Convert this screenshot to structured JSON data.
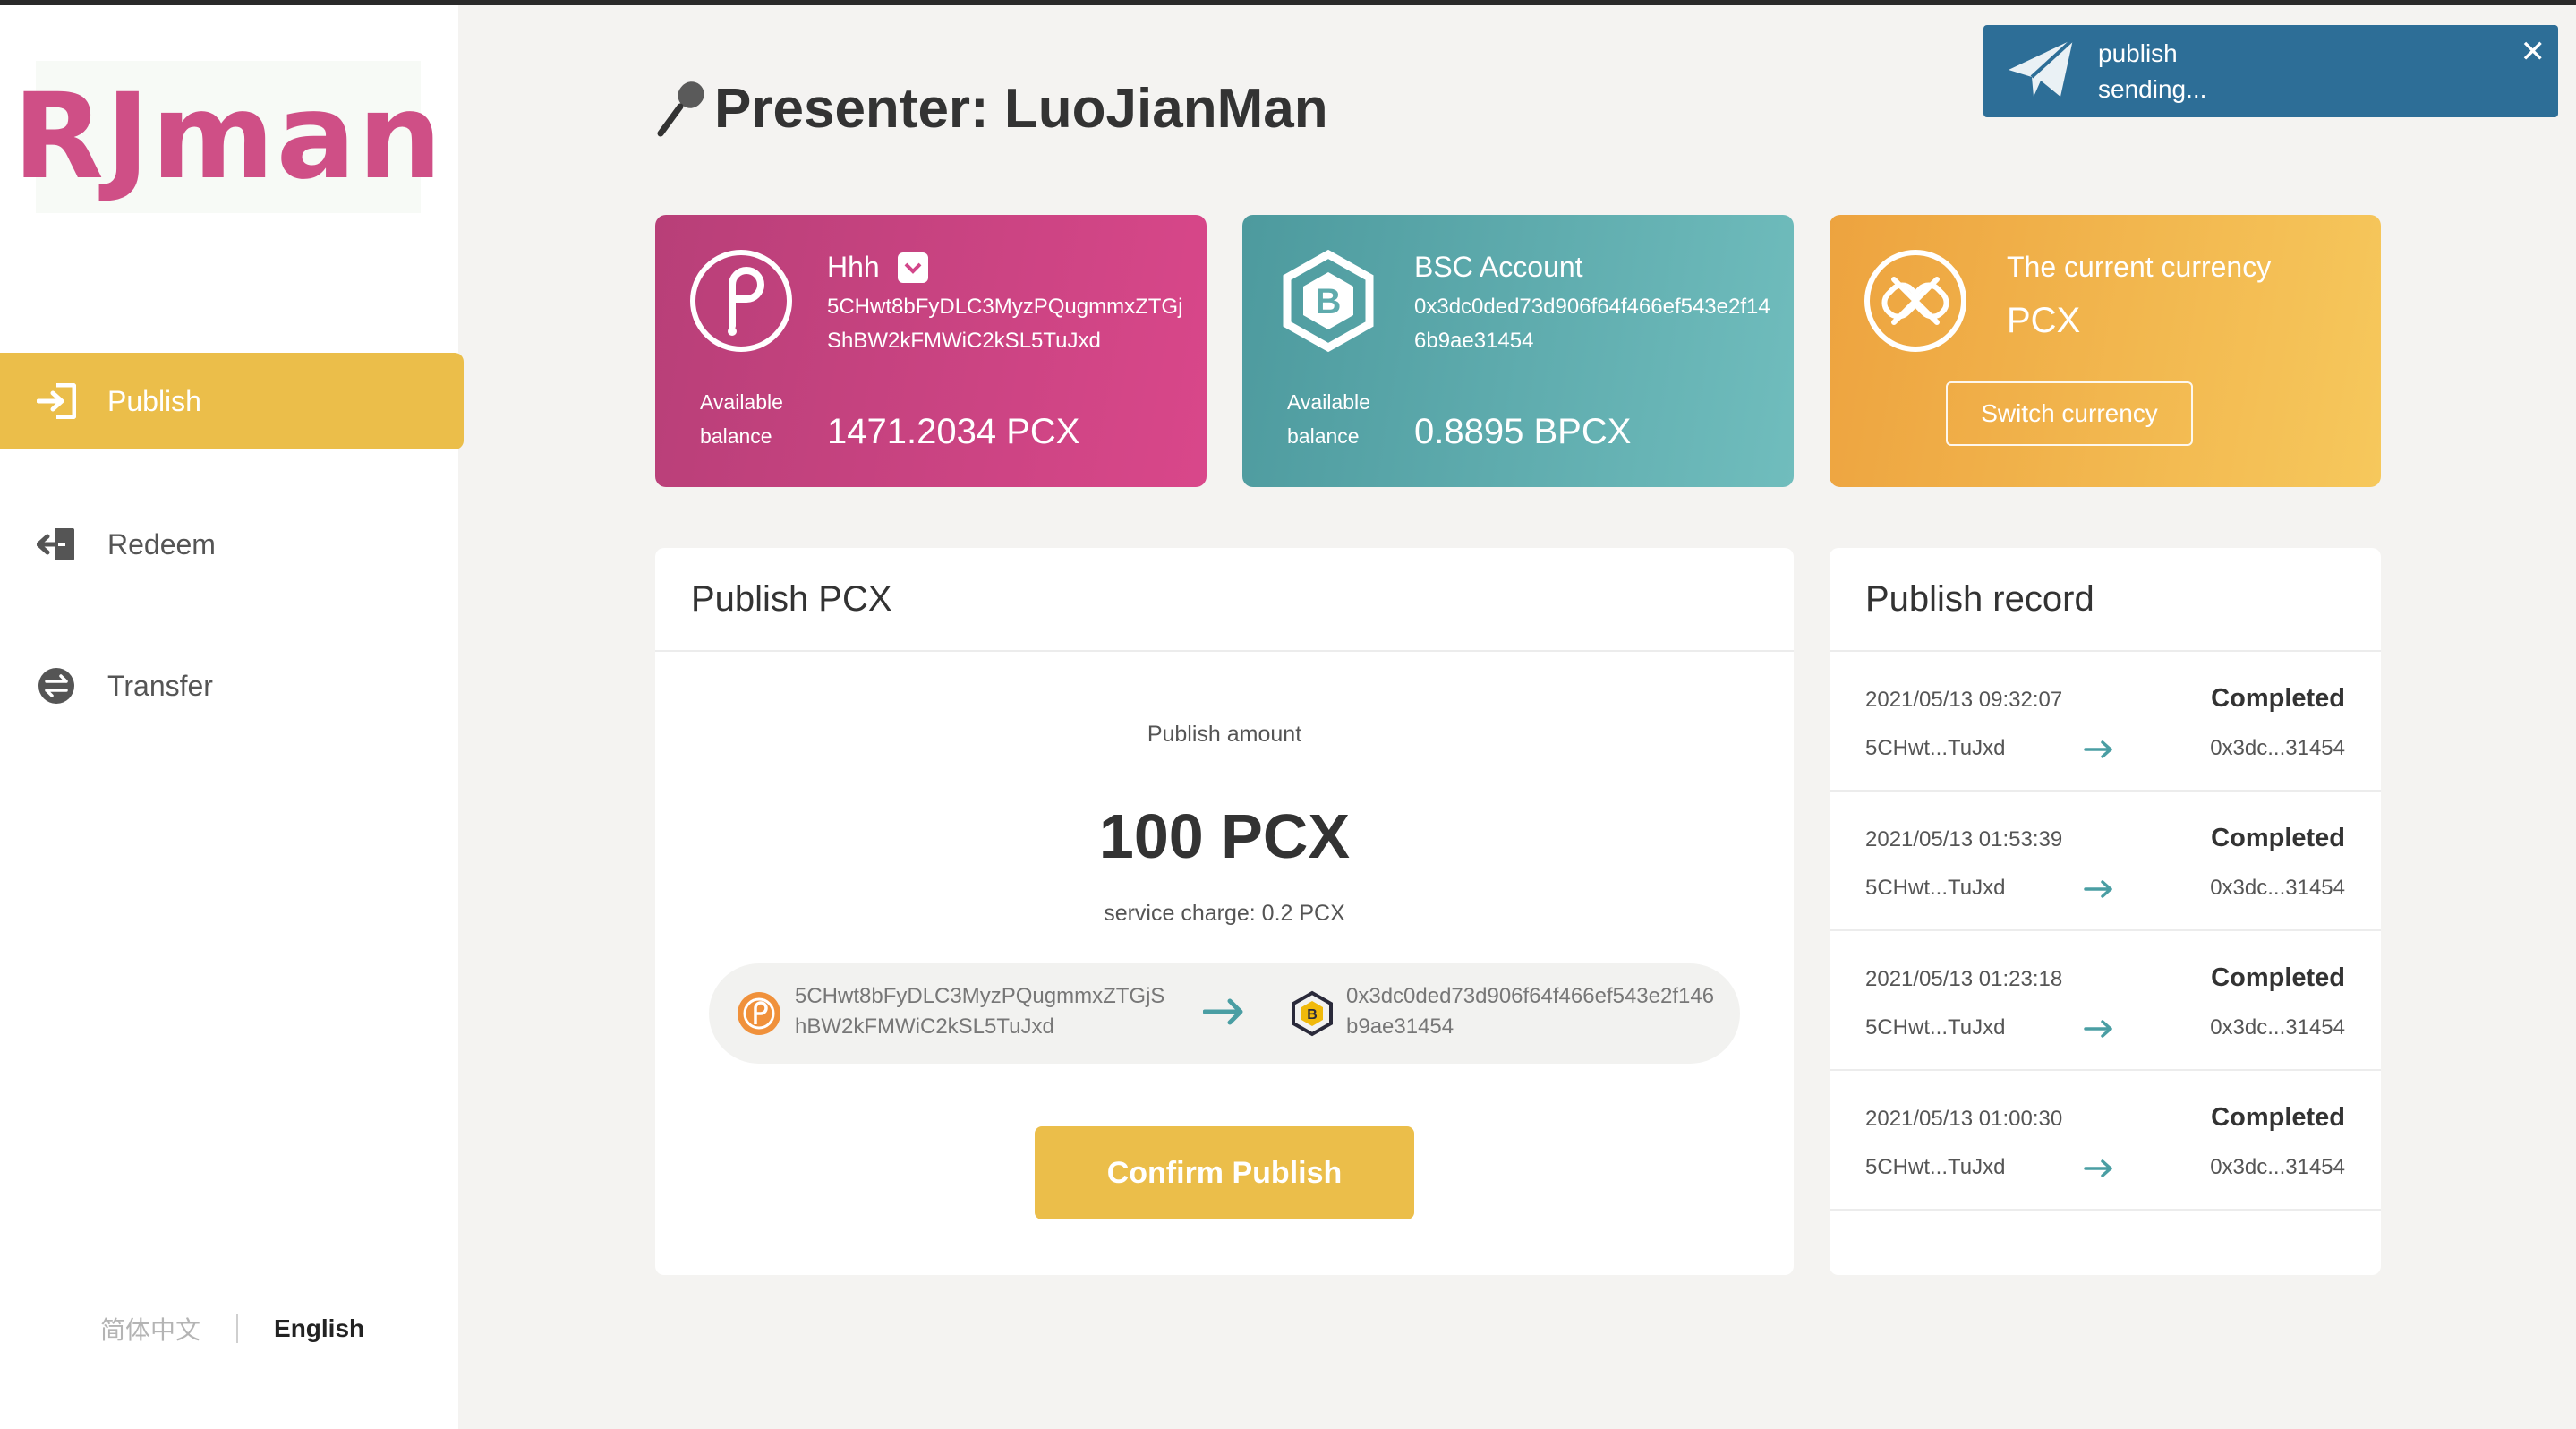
{
  "app": {
    "logo_text": "RJman"
  },
  "sidebar": {
    "items": [
      {
        "label": "Publish",
        "icon": "publish-icon",
        "active": true
      },
      {
        "label": "Redeem",
        "icon": "redeem-icon",
        "active": false
      },
      {
        "label": "Transfer",
        "icon": "transfer-icon",
        "active": false
      }
    ],
    "lang_zh": "简体中文",
    "lang_en": "English"
  },
  "header": {
    "presenter": "Presenter: LuoJianMan"
  },
  "toast": {
    "title": "publish",
    "message": "sending...",
    "close": "✕"
  },
  "cards": {
    "account": {
      "name": "Hhh",
      "address": "5CHwt8bFyDLC3MyzPQugmmxZTGjShBW2kFMWiC2kSL5TuJxd",
      "avail_line1": "Available",
      "avail_line2": "balance",
      "balance": "1471.2034 PCX"
    },
    "bsc": {
      "name": "BSC Account",
      "address": "0x3dc0ded73d906f64f466ef543e2f146b9ae31454",
      "avail_line1": "Available",
      "avail_line2": "balance",
      "balance": "0.8895 BPCX"
    },
    "currency": {
      "title": "The current currency",
      "value": "PCX",
      "switch_label": "Switch currency"
    }
  },
  "publish": {
    "title": "Publish PCX",
    "amount_label": "Publish amount",
    "amount": "100 PCX",
    "service_charge": "service charge:  0.2 PCX",
    "from_address": "5CHwt8bFyDLC3MyzPQugmmxZTGjShBW2kFMWiC2kSL5TuJxd",
    "to_address": "0x3dc0ded73d906f64f466ef543e2f146b9ae31454",
    "confirm_label": "Confirm Publish"
  },
  "records": {
    "title": "Publish record",
    "items": [
      {
        "date": "2021/05/13 09:32:07",
        "status": "Completed",
        "from": "5CHwt...TuJxd",
        "to": "0x3dc...31454"
      },
      {
        "date": "2021/05/13 01:53:39",
        "status": "Completed",
        "from": "5CHwt...TuJxd",
        "to": "0x3dc...31454"
      },
      {
        "date": "2021/05/13 01:23:18",
        "status": "Completed",
        "from": "5CHwt...TuJxd",
        "to": "0x3dc...31454"
      },
      {
        "date": "2021/05/13 01:00:30",
        "status": "Completed",
        "from": "5CHwt...TuJxd",
        "to": "0x3dc...31454"
      }
    ]
  },
  "colors": {
    "accent": "#ebbe4a",
    "pink_card": "#d9478a",
    "teal_card": "#5fabad",
    "orange_card": "#f2b54e",
    "toast": "#2d6e97",
    "arrow": "#4a9ea3"
  }
}
